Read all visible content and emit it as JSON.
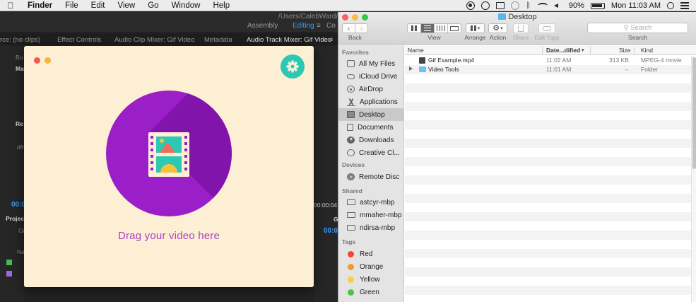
{
  "menubar": {
    "app_name": "Finder",
    "items": [
      "File",
      "Edit",
      "View",
      "Go",
      "Window",
      "Help"
    ],
    "battery": "90%",
    "clock": "Mon 11:03 AM"
  },
  "premiere": {
    "path": "/Users/CalebWard/Dov",
    "workspaces": [
      "Assembly",
      "Editing",
      "≡",
      "Co"
    ],
    "tabs": [
      "rce: (no clips)",
      "Effect Controls",
      "Audio Clip Mixer: Gif Video",
      "Metadata",
      "Audio Track Mixer: Gif Video",
      "≡"
    ],
    "left_fragments": [
      "Bu",
      "Ma",
      "Re",
      "d8",
      "00:0",
      "Projec",
      "Gi",
      "Na"
    ],
    "right_fragments": [
      "00:00:04",
      "G",
      "00:0"
    ]
  },
  "gifapp": {
    "drop_label": "Drag your video here"
  },
  "finder": {
    "window_title": "Desktop",
    "toolbar": {
      "back": "Back",
      "view": "View",
      "arrange": "Arrange",
      "action": "Action",
      "share": "Share",
      "edit_tags": "Edit Tags",
      "search_label": "Search",
      "search_placeholder": "Search"
    },
    "sidebar": {
      "favorites_head": "Favorites",
      "favorites": [
        "All My Files",
        "iCloud Drive",
        "AirDrop",
        "Applications",
        "Desktop",
        "Documents",
        "Downloads",
        "Creative Cl..."
      ],
      "devices_head": "Devices",
      "devices": [
        "Remote Disc"
      ],
      "shared_head": "Shared",
      "shared": [
        "astcyr-mbp",
        "mmaher-mbp",
        "ndirsa-mbp"
      ],
      "tags_head": "Tags",
      "tags": [
        {
          "name": "Red",
          "color": "#f0463d"
        },
        {
          "name": "Orange",
          "color": "#f49a24"
        },
        {
          "name": "Yellow",
          "color": "#f7d23a"
        },
        {
          "name": "Green",
          "color": "#54c04b"
        }
      ]
    },
    "columns": {
      "name": "Name",
      "date": "Date...dified",
      "size": "Size",
      "kind": "Kind"
    },
    "files": [
      {
        "name": "Gif Example.mp4",
        "date": "11:02 AM",
        "size": "313 KB",
        "kind": "MPEG-4 movie"
      },
      {
        "name": "Video Tools",
        "date": "11:01 AM",
        "size": "--",
        "kind": "Folder"
      }
    ]
  }
}
